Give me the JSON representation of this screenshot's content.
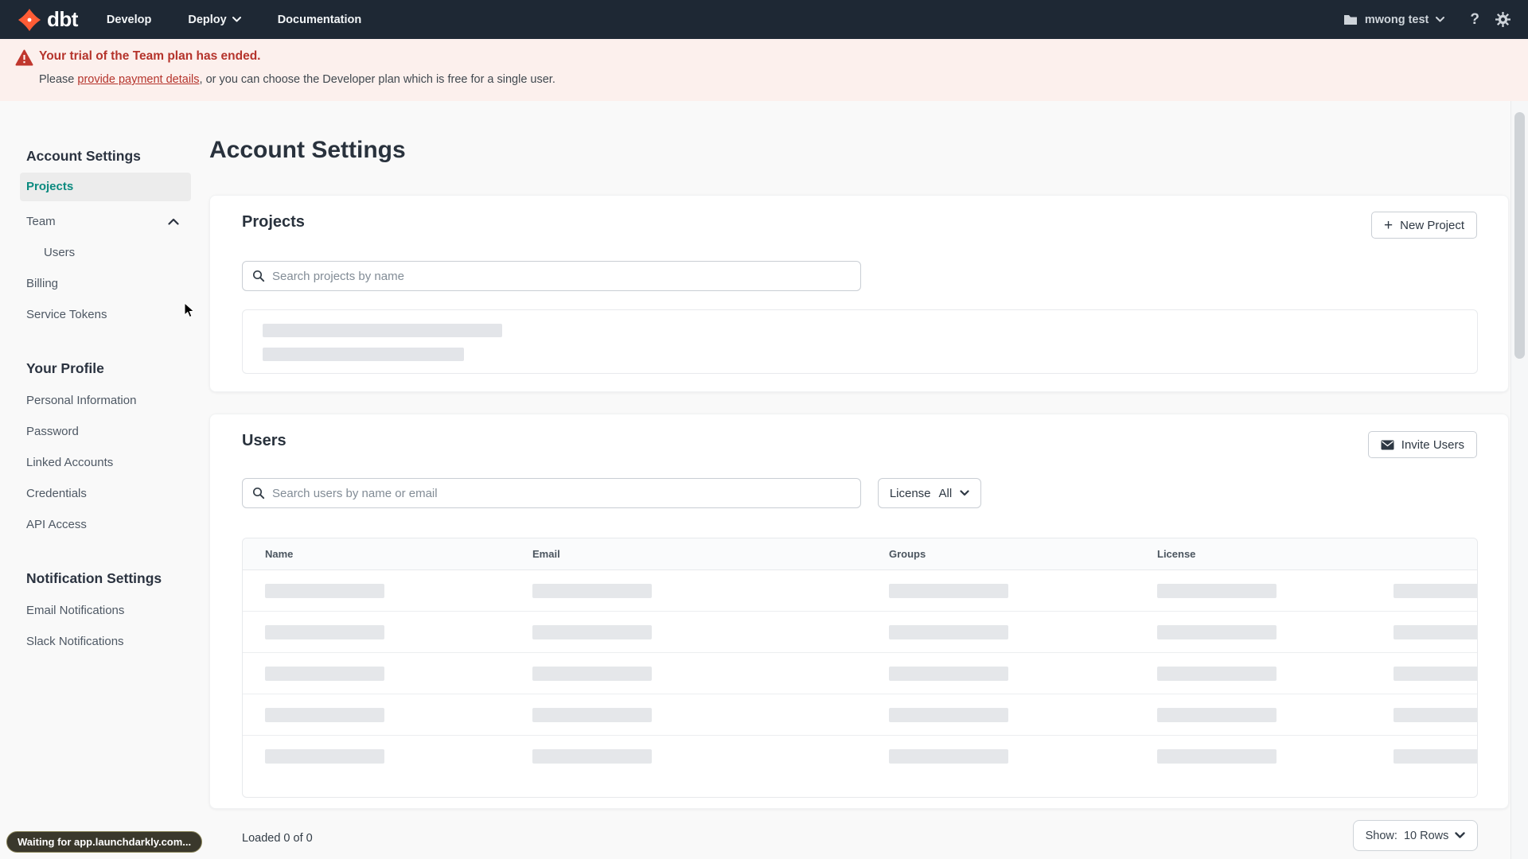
{
  "colors": {
    "brand_orange": "#ff5c35",
    "nav_bg": "#1e2834",
    "accent_teal": "#0b8a7f",
    "alert_red": "#b5342c",
    "alert_bg": "#fcf0ed",
    "skeleton_gray": "#e5e7ea"
  },
  "nav": {
    "brand": "dbt",
    "develop": "Develop",
    "deploy": "Deploy",
    "documentation": "Documentation",
    "account": "mwong test",
    "help": "?"
  },
  "banner": {
    "title": "Your trial of the Team plan has ended.",
    "prefix": "Please ",
    "link": "provide payment details",
    "suffix": ", or you can choose the Developer plan which is free for a single user."
  },
  "sidebar": {
    "section_account": "Account Settings",
    "projects": "Projects",
    "team": "Team",
    "users": "Users",
    "billing": "Billing",
    "service_tokens": "Service Tokens",
    "section_profile": "Your Profile",
    "personal_information": "Personal Information",
    "password": "Password",
    "linked_accounts": "Linked Accounts",
    "credentials": "Credentials",
    "api_access": "API Access",
    "section_notifications": "Notification Settings",
    "email_notifications": "Email Notifications",
    "slack_notifications": "Slack Notifications"
  },
  "main": {
    "title": "Account Settings"
  },
  "projects_card": {
    "title": "Projects",
    "new_project_label": "New Project",
    "search_placeholder": "Search projects by name"
  },
  "users_card": {
    "title": "Users",
    "invite_users_label": "Invite Users",
    "search_placeholder": "Search users by name or email",
    "license_label": "License",
    "license_value": "All",
    "columns": [
      "Name",
      "Email",
      "Groups",
      "License"
    ],
    "loaded_status": "Loaded 0 of 0",
    "show_label": "Show:",
    "show_value": "10 Rows"
  },
  "status": {
    "message": "Waiting for app.launchdarkly.com..."
  }
}
